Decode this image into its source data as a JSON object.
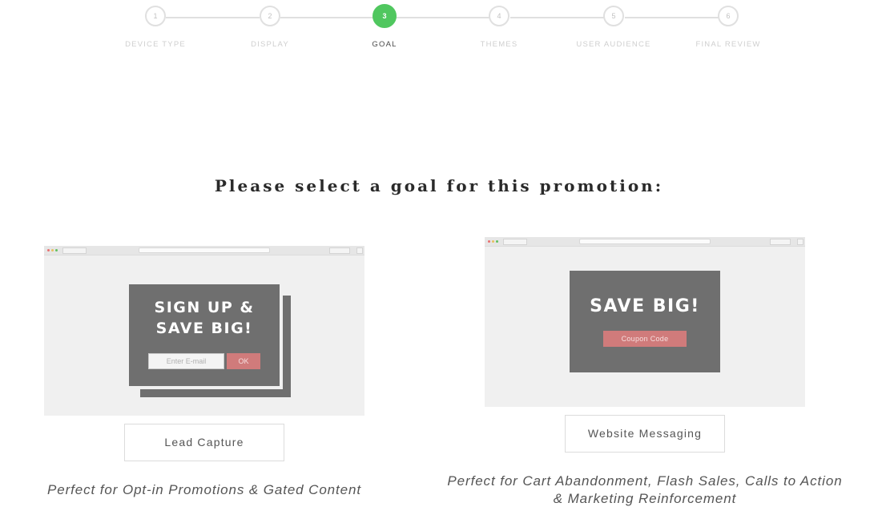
{
  "stepper": {
    "steps": [
      {
        "number": "1",
        "label": "DEVICE TYPE"
      },
      {
        "number": "2",
        "label": "DISPLAY"
      },
      {
        "number": "3",
        "label": "GOAL"
      },
      {
        "number": "4",
        "label": "THEMES"
      },
      {
        "number": "5",
        "label": "USER AUDIENCE"
      },
      {
        "number": "6",
        "label": "FINAL REVIEW"
      }
    ],
    "active_step": "3",
    "colors": {
      "active": "#50c75f",
      "inactive": "#e0e0e0"
    }
  },
  "heading": "Please select a goal for this promotion:",
  "options": [
    {
      "preview": {
        "title_line1": "SIGN UP &",
        "title_line2": "SAVE BIG!",
        "email_placeholder": "Enter E-mail",
        "submit_label": "OK"
      },
      "button_label": "Lead Capture",
      "description": "Perfect for Opt-in Promotions & Gated Content"
    },
    {
      "preview": {
        "title": "SAVE BIG!",
        "coupon_label": "Coupon Code"
      },
      "button_label": "Website Messaging",
      "description_line1": "Perfect for Cart Abandonment, Flash Sales, Calls to Action",
      "description_line2": "& Marketing Reinforcement"
    }
  ]
}
